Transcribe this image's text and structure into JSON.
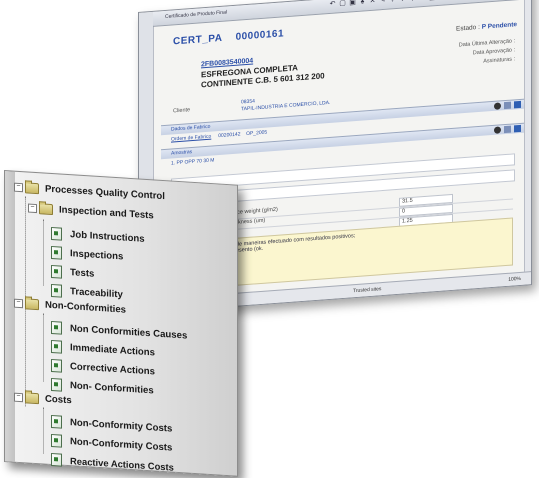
{
  "window": {
    "title": "Certificado de Produto Final",
    "cert_label": "CERT_PA",
    "cert_number": "00000161",
    "estado_label": "Estado :",
    "estado_value": "P Pendente",
    "product_code": "2FB0083540004",
    "product_line1": "ESFREGONA COMPLETA",
    "product_line2": "CONTINENTE C.B. 5 601 312 200",
    "dates": [
      "Data Última Alteração :",
      "Data Aprovação :",
      "Assinaturas :"
    ],
    "cliente_label": "Cliente",
    "cliente_code": "08354",
    "cliente_name": "TAPIL-INDUSTRIA E COMERCIO, LDA.",
    "section_fabrico": "Dados de Fabrico",
    "ordem_label": "Ordem de Fabrico",
    "ordem_value": "00200142",
    "op_value": "OP_2005",
    "section_amostras": "Amostras",
    "amostra_line": "1. PP OPP 70 30 M",
    "table_rows": [
      {
        "label": "ance weight (g/m2)",
        "value": "31.5"
      },
      {
        "label": "hickness (um)",
        "value": "0"
      },
      {
        "label": "",
        "value": "1.25"
      }
    ],
    "note_line1": "de maneiras efectuado com resultados positivos;",
    "note_line2": "esento (ok.",
    "status_trusted": "Trusted sites",
    "status_zoom": "100%"
  },
  "tree": {
    "root": "Processes Quality Control",
    "groups": [
      {
        "label": "Inspection and Tests",
        "items": [
          "Job Instructions",
          "Inspections",
          "Tests",
          "Traceability"
        ]
      },
      {
        "label": "Non-Conformities",
        "items": [
          "Non Conformities Causes",
          "Immediate Actions",
          "Corrective Actions",
          "Non- Conformities"
        ]
      },
      {
        "label": "Costs",
        "items": [
          "Non-Conformity Costs",
          "Non-Conformity Costs",
          "Reactive Actions Costs"
        ]
      }
    ]
  }
}
